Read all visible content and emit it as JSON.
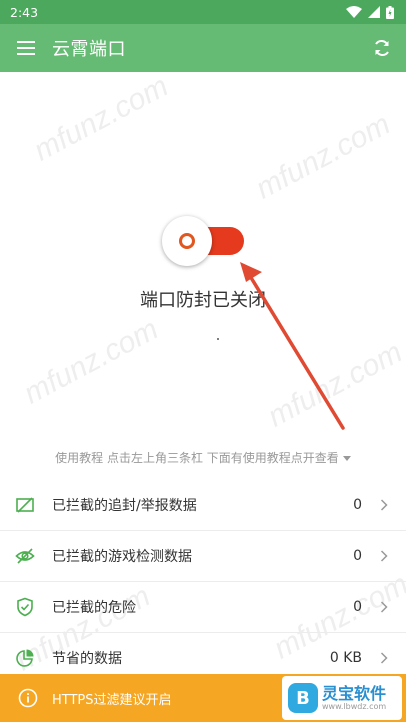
{
  "statusbar": {
    "time": "2:43"
  },
  "appbar": {
    "title": "云霄端口"
  },
  "watermarks": [
    "mfunz.com",
    "mfunz.com",
    "mfunz.com",
    "mfunz.com",
    "mfunz.com",
    "mfunz.com"
  ],
  "main": {
    "toggle_state": "off",
    "status_text": "端口防封已关闭",
    "tutorial_text": "使用教程 点击左上角三条杠 下面有使用教程点开查看"
  },
  "stats": [
    {
      "icon": "blocked-report-icon",
      "label": "已拦截的追封/举报数据",
      "value": "0"
    },
    {
      "icon": "eye-off-icon",
      "label": "已拦截的游戏检测数据",
      "value": "0"
    },
    {
      "icon": "shield-check-icon",
      "label": "已拦截的危险",
      "value": "0"
    },
    {
      "icon": "pie-chart-icon",
      "label": "节省的数据",
      "value": "0 KB"
    }
  ],
  "banner": {
    "text": "HTTPS过滤建议开启"
  },
  "logo": {
    "name": "灵宝软件",
    "url": "www.lbwdz.com",
    "badge": "B"
  },
  "colors": {
    "statusbar": "#4ba85c",
    "appbar": "#66bb74",
    "toggle": "#e53a1d",
    "icon_green": "#4caf50",
    "banner": "#f5a623",
    "arrow": "#e04a33"
  }
}
